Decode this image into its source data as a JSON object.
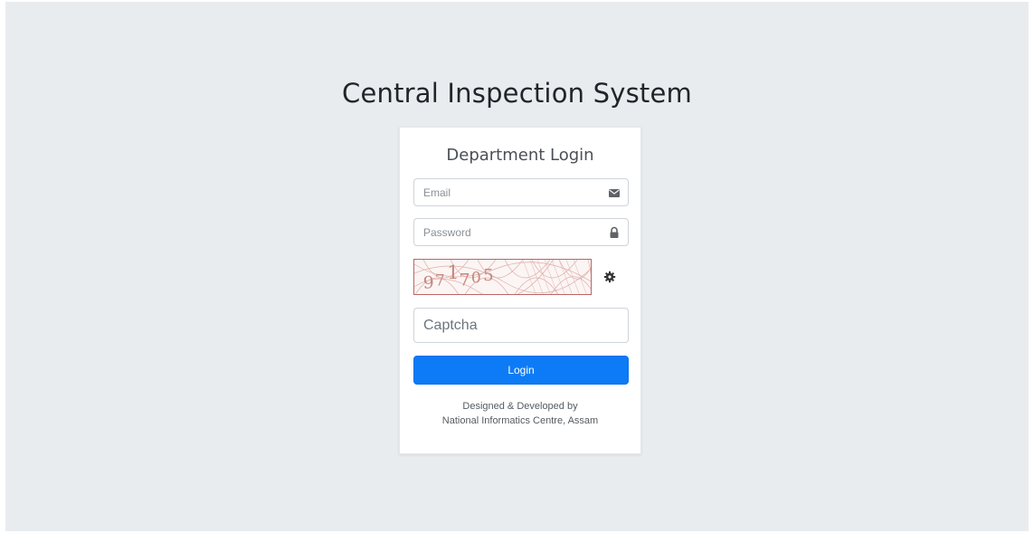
{
  "app": {
    "title": "Central Inspection System"
  },
  "login_card": {
    "title": "Department Login",
    "email": {
      "placeholder": "Email",
      "value": "",
      "icon": "envelope-icon"
    },
    "password": {
      "placeholder": "Password",
      "value": "",
      "icon": "lock-icon"
    },
    "captcha": {
      "image_text": "971705",
      "refresh_icon": "gear-icon",
      "input_placeholder": "Captcha",
      "input_value": ""
    },
    "login_button_label": "Login",
    "footer_line1": "Designed & Developed by",
    "footer_line2": "National Informatics Centre, Assam"
  },
  "colors": {
    "background": "#e9ecef",
    "card": "#ffffff",
    "primary": "#0d7bf5",
    "captcha_ink": "#b05a52"
  }
}
